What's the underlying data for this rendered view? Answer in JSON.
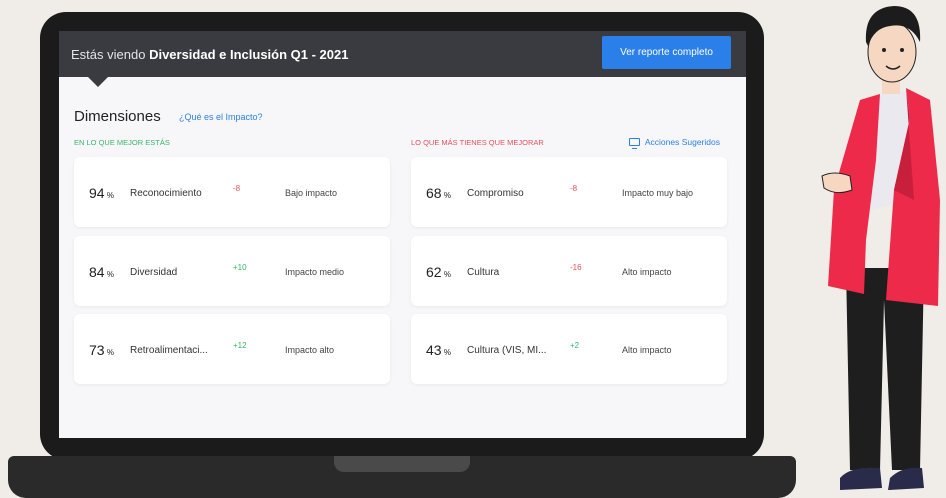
{
  "header": {
    "prefix": "Estás viendo",
    "title": "Diversidad e Inclusión Q1 - 2021",
    "report_button": "Ver reporte completo"
  },
  "dimensions": {
    "title": "Dimensiones",
    "help_link": "¿Qué es el Impacto?",
    "best_label": "EN LO QUE MEJOR ESTÁS",
    "improve_label": "LO QUE MÁS TIENES QUE MEJORAR",
    "suggested_actions": "Acciones Sugeridos"
  },
  "best": [
    {
      "pct": "94",
      "unit": "%",
      "name": "Reconocimiento",
      "delta": "-8",
      "impact": "Bajo impacto"
    },
    {
      "pct": "84",
      "unit": "%",
      "name": "Diversidad",
      "delta": "+10",
      "impact": "Impacto medio"
    },
    {
      "pct": "73",
      "unit": "%",
      "name": "Retroalimentaci...",
      "delta": "+12",
      "impact": "Impacto alto"
    }
  ],
  "improve": [
    {
      "pct": "68",
      "unit": "%",
      "name": "Compromiso",
      "delta": "-8",
      "impact": "Impacto muy bajo"
    },
    {
      "pct": "62",
      "unit": "%",
      "name": "Cultura",
      "delta": "-16",
      "impact": "Alto impacto"
    },
    {
      "pct": "43",
      "unit": "%",
      "name": "Cultura (VIS, MI...",
      "delta": "+2",
      "impact": "Alto impacto"
    }
  ],
  "colors": {
    "accent": "#2b7fe8",
    "positive": "#3ab56a",
    "negative": "#e5505a",
    "header_bg": "#3a3b40",
    "jacket": "#ee2a4a"
  }
}
